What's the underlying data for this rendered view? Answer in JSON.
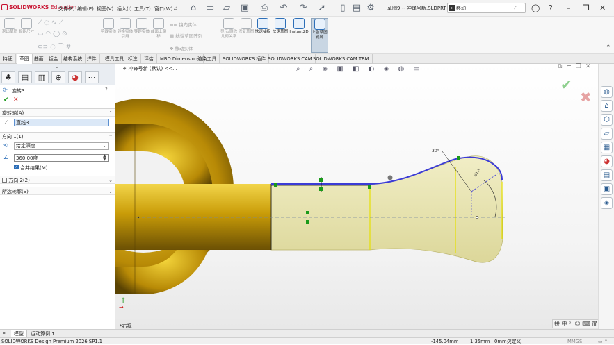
{
  "app": {
    "logo_prefix": "3S",
    "logo": "SOLIDWORKS",
    "logo_suffix": "Education"
  },
  "menu": [
    "文件(F)",
    "编辑(E)",
    "视图(V)",
    "插入(I)",
    "工具(T)",
    "窗口(W)"
  ],
  "document_title": "草图9 -- 冲锋号新.SLDPRT *",
  "search": {
    "placeholder": "移动"
  },
  "command_manager": {
    "buttons": [
      "退出草图",
      "智能尺寸",
      "剪裁实体",
      "转换实体引用",
      "等距实体",
      "曲面上偏移",
      "镜向实体",
      "线性草图阵列",
      "移动实体",
      "显示/删除几何关系",
      "修复草图",
      "快速捕捉",
      "快速草图",
      "Instant2D",
      "上色草图轮廓"
    ],
    "active_buttons": [
      "快速捕捉",
      "快速草图",
      "Instant2D"
    ],
    "selected_button": "上色草图轮廓"
  },
  "tabs": [
    "特征",
    "草图",
    "曲面",
    "钣金",
    "结构系统",
    "焊件",
    "模具工具",
    "标注",
    "评估",
    "MBD Dimensions",
    "渲染工具",
    "SOLIDWORKS 插件",
    "SOLIDWORKS CAM",
    "SOLIDWORKS CAM TBM"
  ],
  "active_tab": "草图",
  "panel": {
    "feature_title": "旋转3",
    "ok_icon": "check-icon",
    "cancel_icon": "x-icon",
    "axis": {
      "header": "旋转轴(A)",
      "value": "直线3"
    },
    "direction1": {
      "header": "方向 1(1)",
      "type": "给定深度",
      "angle": "360.00度",
      "merge_label": "合并结果(M)",
      "merge_checked": true
    },
    "direction2": {
      "header": "方向 2(2)",
      "checked": false
    },
    "contours": {
      "header": "所选轮廓(S)"
    }
  },
  "viewport": {
    "breadcrumb": "冲锋号新 (默认) <<...",
    "angle_label": "30°",
    "dim_label": "Ø1.5",
    "view_label": "*右视"
  },
  "bottom_tabs": [
    "模型",
    "运动算例 1"
  ],
  "status": {
    "product": "SOLIDWORKS Design Premium 2026 SP1.1",
    "x": "-145.04mm",
    "y": "1.35mm",
    "z": "0mm",
    "state": "欠定义",
    "units": "MMGS"
  },
  "colors": {
    "accent": "#2d6fb8",
    "solid": "#d4af12",
    "preview": "#e7e3a8",
    "profile": "#3b3bd6"
  }
}
